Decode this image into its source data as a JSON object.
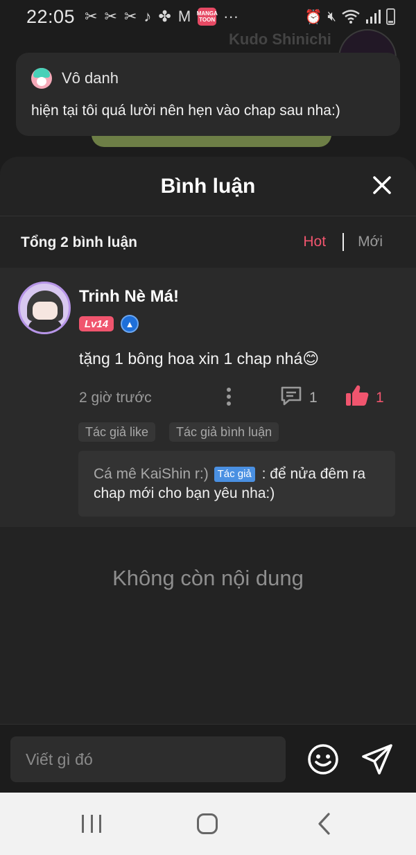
{
  "status_bar": {
    "time": "22:05",
    "manga_badge": "MANGA TOON",
    "more": "···"
  },
  "background": {
    "author_name": "Kudo Shinichi"
  },
  "notification": {
    "sender": "Vô danh",
    "message": "hiện tại tôi quá lười nên hẹn vào chap sau nha:)"
  },
  "sheet": {
    "title": "Bình luận",
    "total_label": "Tổng 2 bình luận",
    "sort": {
      "hot": "Hot",
      "new": "Mới",
      "active": "hot"
    }
  },
  "comment": {
    "user": "Trinh Nè Má!",
    "level": "Lv14",
    "text": "tặng 1 bông hoa xin 1 chap nhá😊",
    "time": "2 giờ trước",
    "reply_count": "1",
    "like_count": "1",
    "tags": [
      "Tác giả like",
      "Tác giả bình luận"
    ],
    "reply": {
      "author": "Cá mê KaiShin r:)",
      "badge": "Tác giả",
      "text": ": để nửa đêm ra chap mới cho bạn yêu nha:)"
    }
  },
  "empty_state": "Không còn nội dung",
  "input": {
    "placeholder": "Viết gì đó"
  },
  "colors": {
    "accent": "#f0556e",
    "author_badge": "#4a90e2",
    "sheet_bg": "#232323"
  }
}
